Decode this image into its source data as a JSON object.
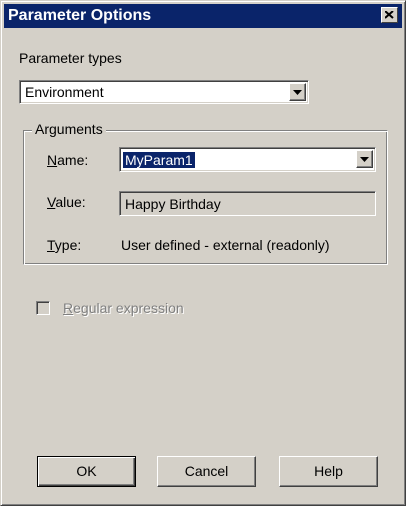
{
  "window": {
    "title": "Parameter Options"
  },
  "parameter_types": {
    "label": "Parameter types",
    "value": "Environment"
  },
  "arguments": {
    "legend": "Arguments",
    "name": {
      "label_key": "N",
      "label_rest": "ame:",
      "value": "MyParam1"
    },
    "value": {
      "label_key": "V",
      "label_rest": "alue:",
      "value": "Happy Birthday"
    },
    "type": {
      "label_key": "T",
      "label_rest": "ype:",
      "value": "User defined - external (readonly)"
    }
  },
  "regex": {
    "label_key": "R",
    "label_rest": "egular expression",
    "checked": false,
    "enabled": false
  },
  "buttons": {
    "ok": "OK",
    "cancel": "Cancel",
    "help": "Help"
  },
  "icons": {
    "close": "close-icon",
    "dropdown": "chevron-down-icon"
  }
}
